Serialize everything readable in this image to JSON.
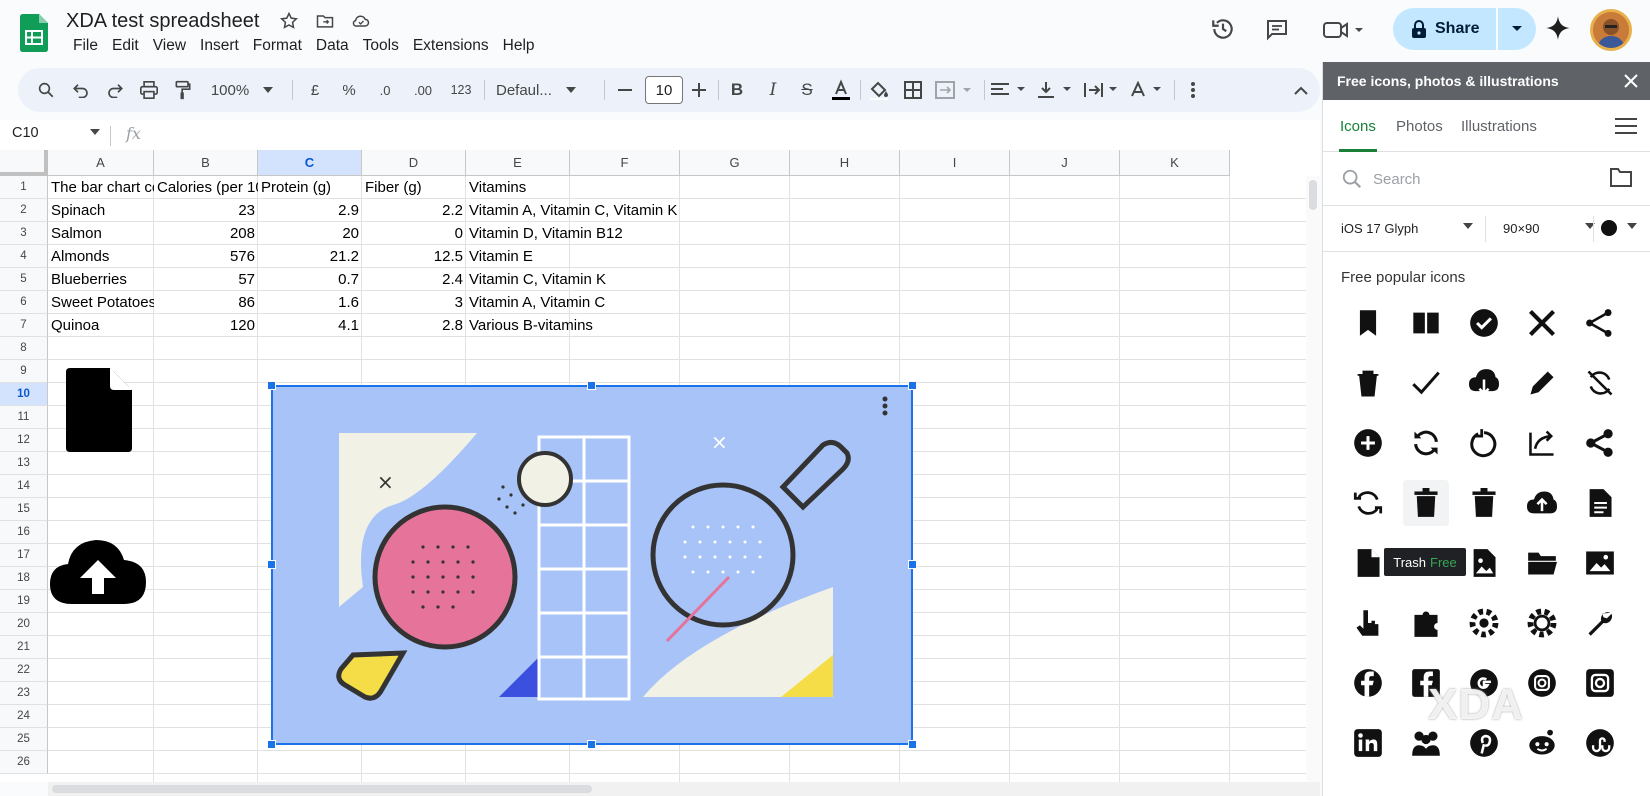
{
  "doc": {
    "title": "XDA test spreadsheet"
  },
  "menu": [
    "File",
    "Edit",
    "View",
    "Insert",
    "Format",
    "Data",
    "Tools",
    "Extensions",
    "Help"
  ],
  "share": {
    "label": "Share"
  },
  "toolbar": {
    "zoom": "100%",
    "currency": "£",
    "percent": "%",
    "dec_less": ".0",
    "dec_more": ".00",
    "number_format": "123",
    "font": "Defaul...",
    "font_size": "10"
  },
  "formula": {
    "namebox": "C10",
    "fx": "fx"
  },
  "columns": [
    "A",
    "B",
    "C",
    "D",
    "E",
    "F",
    "G",
    "H",
    "I",
    "J",
    "K"
  ],
  "selected_column": "C",
  "selected_row": "10",
  "rows": [
    "1",
    "2",
    "3",
    "4",
    "5",
    "6",
    "7",
    "8",
    "9",
    "10",
    "11",
    "12",
    "13",
    "14",
    "15",
    "16",
    "17",
    "18",
    "19",
    "20",
    "21",
    "22",
    "23",
    "24",
    "25",
    "26"
  ],
  "sheet": {
    "headers": [
      "The bar chart co",
      "Calories (per 10(",
      "Protein (g)",
      "Fiber (g)",
      "Vitamins"
    ],
    "rows": [
      [
        "Spinach",
        "23",
        "2.9",
        "2.2",
        "Vitamin A, Vitamin C, Vitamin K"
      ],
      [
        "Salmon",
        "208",
        "20",
        "0",
        "Vitamin D, Vitamin B12"
      ],
      [
        "Almonds",
        "576",
        "21.2",
        "12.5",
        "Vitamin E"
      ],
      [
        "Blueberries",
        "57",
        "0.7",
        "2.4",
        "Vitamin C, Vitamin K"
      ],
      [
        "Sweet Potatoes",
        "86",
        "1.6",
        "3",
        "Vitamin A, Vitamin C"
      ],
      [
        "Quinoa",
        "120",
        "4.1",
        "2.8",
        "Various B-vitamins"
      ]
    ]
  },
  "panel": {
    "title": "Free icons, photos & illustrations",
    "tabs": [
      "Icons",
      "Photos",
      "Illustrations"
    ],
    "search_placeholder": "Search",
    "style_filter": "iOS 17 Glyph",
    "size_filter": "90×90",
    "popular_heading": "Free popular icons",
    "tooltip": {
      "name": "Trash",
      "tag": "Free"
    },
    "icons": [
      "bookmark-icon",
      "book-icon",
      "checkmark-circle-icon",
      "close-icon",
      "share-icon",
      "trash-icon",
      "checkmark-icon",
      "cloud-download-icon",
      "pencil-icon",
      "sync-off-icon",
      "add-circle-icon",
      "refresh-icon",
      "restart-icon",
      "export-icon",
      "share-nodes-icon",
      "sync-icon",
      "trash-filled-icon",
      "trash-can-icon",
      "cloud-upload-icon",
      "document-icon",
      "file-icon",
      "folder-icon",
      "image-file-icon",
      "open-folder-icon",
      "picture-icon",
      "hand-pointer-icon",
      "puzzle-icon",
      "gears-icon",
      "gear-icon",
      "wrench-icon",
      "facebook-icon",
      "facebook-square-icon",
      "google-icon",
      "instagram-icon",
      "instagram-square-icon",
      "linkedin-icon",
      "group-icon",
      "pinterest-icon",
      "reddit-icon",
      "stumbleupon-icon"
    ]
  },
  "watermark": "XDA"
}
